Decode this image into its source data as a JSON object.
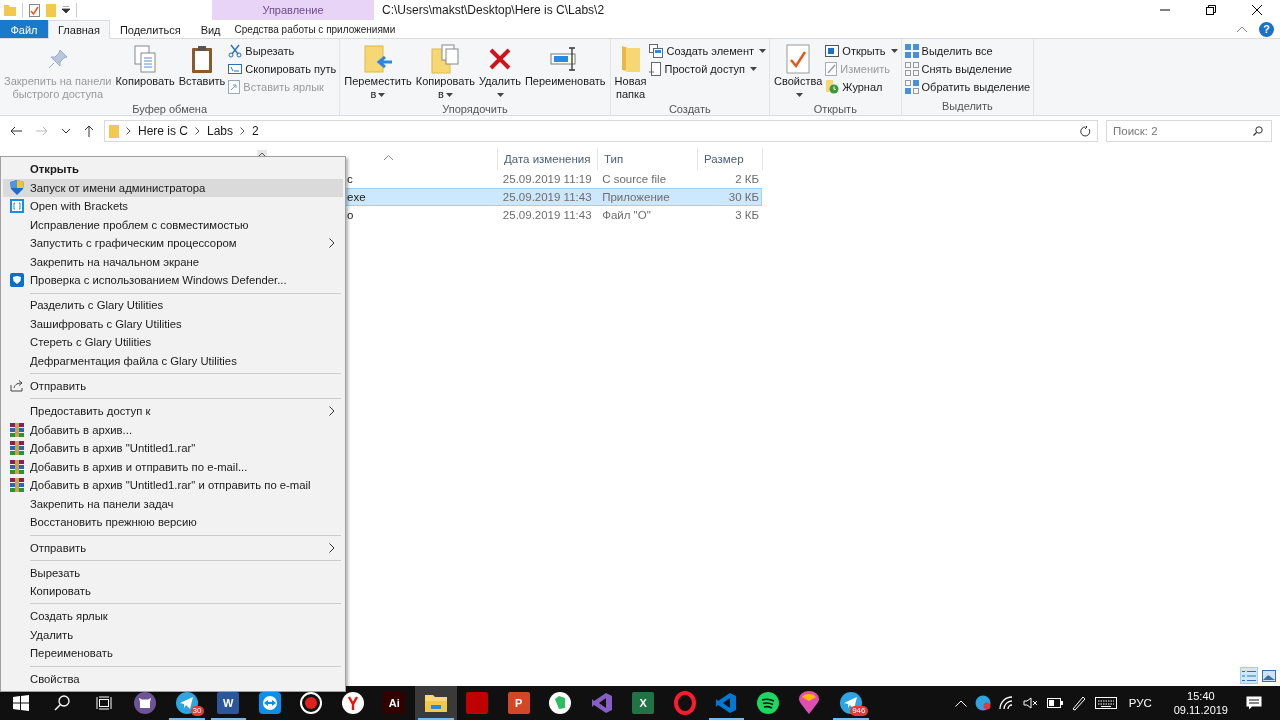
{
  "title_bar": {
    "contextual_header": "Управление",
    "path": "C:\\Users\\makst\\Desktop\\Here is C\\Labs\\2"
  },
  "tabs": [
    {
      "label": "Файл",
      "kind": "file",
      "selected": false
    },
    {
      "label": "Главная",
      "kind": "normal",
      "selected": true
    },
    {
      "label": "Поделиться",
      "kind": "normal",
      "selected": false
    },
    {
      "label": "Вид",
      "kind": "normal",
      "selected": false
    },
    {
      "label": "Средства работы с приложениями",
      "kind": "contextual",
      "selected": false
    }
  ],
  "help": "?",
  "ribbon": [
    {
      "title": "Буфер обмена",
      "controls": [
        {
          "kind": "large",
          "lines": [
            "Закрепить на панели",
            "быстрого доступа"
          ],
          "disabled": true,
          "dropdown": false
        },
        {
          "kind": "large",
          "lines": [
            "Копировать"
          ],
          "disabled": false,
          "dropdown": false
        },
        {
          "kind": "large",
          "lines": [
            "Вставить"
          ],
          "disabled": false,
          "dropdown": false
        },
        {
          "kind": "stack",
          "items": [
            {
              "label": "Вырезать",
              "disabled": false,
              "dropdown": false
            },
            {
              "label": "Скопировать путь",
              "disabled": false,
              "dropdown": false
            },
            {
              "label": "Вставить ярлык",
              "disabled": true,
              "dropdown": false
            }
          ]
        }
      ]
    },
    {
      "title": "Упорядочить",
      "controls": [
        {
          "kind": "large",
          "lines": [
            "Переместить",
            "в"
          ],
          "disabled": false,
          "dropdown": true
        },
        {
          "kind": "large",
          "lines": [
            "Копировать",
            "в"
          ],
          "disabled": false,
          "dropdown": true
        },
        {
          "kind": "large",
          "lines": [
            "Удалить"
          ],
          "disabled": false,
          "dropdown": true
        },
        {
          "kind": "large",
          "lines": [
            "Переименовать"
          ],
          "disabled": false,
          "dropdown": false
        }
      ]
    },
    {
      "title": "Создать",
      "controls": [
        {
          "kind": "large",
          "lines": [
            "Новая",
            "папка"
          ],
          "disabled": false,
          "dropdown": false
        },
        {
          "kind": "stack",
          "items": [
            {
              "label": "Создать элемент",
              "disabled": false,
              "dropdown": true
            },
            {
              "label": "Простой доступ",
              "disabled": false,
              "dropdown": true
            }
          ]
        }
      ]
    },
    {
      "title": "Открыть",
      "controls": [
        {
          "kind": "large",
          "lines": [
            "Свойства"
          ],
          "disabled": false,
          "dropdown": true
        },
        {
          "kind": "stack",
          "items": [
            {
              "label": "Открыть",
              "disabled": false,
              "dropdown": true
            },
            {
              "label": "Изменить",
              "disabled": true,
              "dropdown": false
            },
            {
              "label": "Журнал",
              "disabled": false,
              "dropdown": false
            }
          ]
        }
      ]
    },
    {
      "title": "Выделить",
      "controls": [
        {
          "kind": "stack",
          "items": [
            {
              "label": "Выделить все",
              "disabled": false,
              "dropdown": false
            },
            {
              "label": "Снять выделение",
              "disabled": false,
              "dropdown": false
            },
            {
              "label": "Обратить выделение",
              "disabled": false,
              "dropdown": false
            }
          ]
        }
      ]
    }
  ],
  "address_bar": {
    "breadcrumbs": [
      "Here is C",
      "Labs",
      "2"
    ],
    "search_placeholder": "Поиск: 2"
  },
  "file_list": {
    "columns": [
      "Дата изменения",
      "Тип",
      "Размер"
    ],
    "rows": [
      {
        "name": "c",
        "date": "25.09.2019 11:19",
        "type": "C source file",
        "size": "2 КБ",
        "selected": false
      },
      {
        "name": "exe",
        "date": "25.09.2019 11:43",
        "type": "Приложение",
        "size": "30 КБ",
        "selected": true
      },
      {
        "name": "o",
        "date": "25.09.2019 11:43",
        "type": "Файл \"O\"",
        "size": "3 КБ",
        "selected": false
      }
    ]
  },
  "context_menu": [
    {
      "kind": "item",
      "label": "Открыть",
      "default": true,
      "selected": false,
      "submenu": false
    },
    {
      "kind": "item",
      "label": "Запуск от имени администратора",
      "default": false,
      "selected": true,
      "submenu": false
    },
    {
      "kind": "item",
      "label": "Open with Brackets",
      "default": false,
      "selected": false,
      "submenu": false
    },
    {
      "kind": "item",
      "label": "Исправление проблем с совместимостью",
      "default": false,
      "selected": false,
      "submenu": false
    },
    {
      "kind": "item",
      "label": "Запустить с графическим процессором",
      "default": false,
      "selected": false,
      "submenu": true
    },
    {
      "kind": "item",
      "label": "Закрепить на начальном экране",
      "default": false,
      "selected": false,
      "submenu": false
    },
    {
      "kind": "item",
      "label": "Проверка с использованием Windows Defender...",
      "default": false,
      "selected": false,
      "submenu": false
    },
    {
      "kind": "separator"
    },
    {
      "kind": "item",
      "label": "Разделить с Glary Utilities",
      "default": false,
      "selected": false,
      "submenu": false
    },
    {
      "kind": "item",
      "label": "Зашифровать с Glary Utilities",
      "default": false,
      "selected": false,
      "submenu": false
    },
    {
      "kind": "item",
      "label": "Стереть с Glary Utilities",
      "default": false,
      "selected": false,
      "submenu": false
    },
    {
      "kind": "item",
      "label": "Дефрагментация файла с Glary Utilities",
      "default": false,
      "selected": false,
      "submenu": false
    },
    {
      "kind": "separator"
    },
    {
      "kind": "item",
      "label": "Отправить",
      "default": false,
      "selected": false,
      "submenu": false
    },
    {
      "kind": "separator"
    },
    {
      "kind": "item",
      "label": "Предоставить доступ к",
      "default": false,
      "selected": false,
      "submenu": true
    },
    {
      "kind": "item",
      "label": "Добавить в архив...",
      "default": false,
      "selected": false,
      "submenu": false
    },
    {
      "kind": "item",
      "label": "Добавить в архив \"Untitled1.rar\"",
      "default": false,
      "selected": false,
      "submenu": false
    },
    {
      "kind": "item",
      "label": "Добавить в архив и отправить по e-mail...",
      "default": false,
      "selected": false,
      "submenu": false
    },
    {
      "kind": "item",
      "label": "Добавить в архив \"Untitled1.rar\" и отправить по e-mail",
      "default": false,
      "selected": false,
      "submenu": false
    },
    {
      "kind": "item",
      "label": "Закрепить на панели задач",
      "default": false,
      "selected": false,
      "submenu": false
    },
    {
      "kind": "item",
      "label": "Восстановить прежнюю версию",
      "default": false,
      "selected": false,
      "submenu": false
    },
    {
      "kind": "separator"
    },
    {
      "kind": "item",
      "label": "Отправить",
      "default": false,
      "selected": false,
      "submenu": true
    },
    {
      "kind": "separator"
    },
    {
      "kind": "item",
      "label": "Вырезать",
      "default": false,
      "selected": false,
      "submenu": false
    },
    {
      "kind": "item",
      "label": "Копировать",
      "default": false,
      "selected": false,
      "submenu": false
    },
    {
      "kind": "separator"
    },
    {
      "kind": "item",
      "label": "Создать ярлык",
      "default": false,
      "selected": false,
      "submenu": false
    },
    {
      "kind": "item",
      "label": "Удалить",
      "default": false,
      "selected": false,
      "submenu": false
    },
    {
      "kind": "item",
      "label": "Переименовать",
      "default": false,
      "selected": false,
      "submenu": false
    },
    {
      "kind": "separator"
    },
    {
      "kind": "item",
      "label": "Свойства",
      "default": false,
      "selected": false,
      "submenu": false
    }
  ],
  "view_buttons": [
    {
      "selected": true
    },
    {
      "selected": false
    }
  ],
  "taskbar": {
    "apps": [
      {
        "running": false,
        "active": false
      },
      {
        "running": true,
        "active": false,
        "badge": "30"
      },
      {
        "running": true,
        "active": false,
        "glyph": "W"
      },
      {
        "running": false,
        "active": false
      },
      {
        "running": false,
        "active": false
      },
      {
        "running": false,
        "active": false
      },
      {
        "running": false,
        "active": false,
        "glyph": "Ai"
      },
      {
        "running": true,
        "active": true
      },
      {
        "running": false,
        "active": false
      },
      {
        "running": false,
        "active": false,
        "glyph": "P"
      },
      {
        "running": false,
        "active": false
      },
      {
        "running": false,
        "active": false
      },
      {
        "running": false,
        "active": false,
        "glyph": "X"
      },
      {
        "running": false,
        "active": false
      },
      {
        "running": true,
        "active": false
      },
      {
        "running": false,
        "active": false
      },
      {
        "running": false,
        "active": false
      },
      {
        "running": true,
        "active": false,
        "badge": "946"
      }
    ],
    "language": "РУС",
    "time": "15:40",
    "date": "09.11.2019"
  }
}
